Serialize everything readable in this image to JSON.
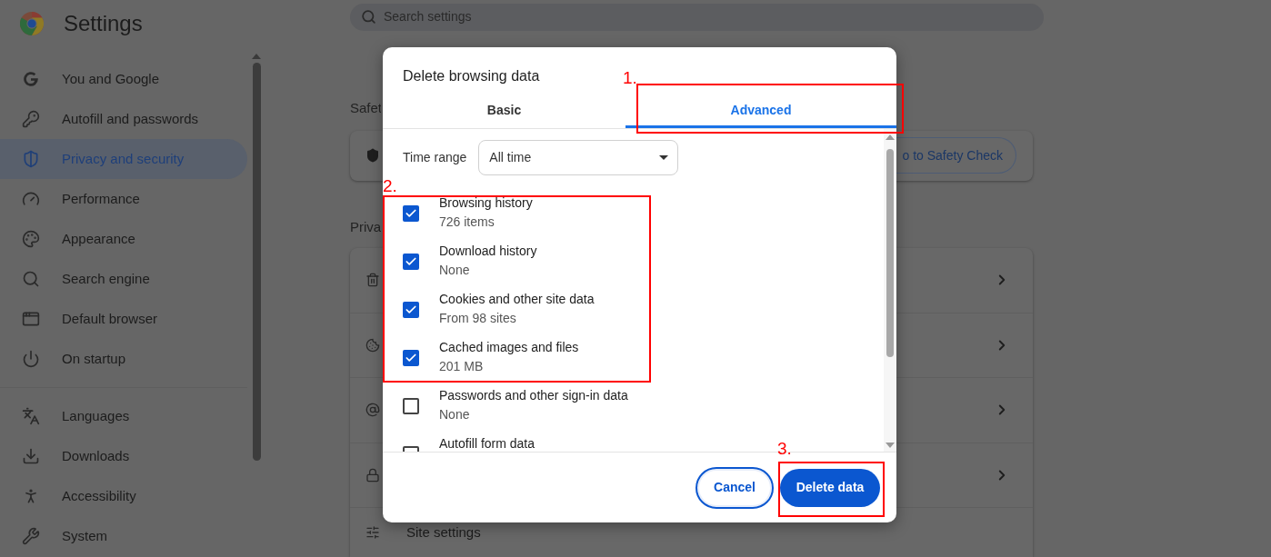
{
  "header": {
    "title": "Settings",
    "search": {
      "placeholder": "Search settings"
    }
  },
  "sidebar": {
    "groups": [
      [
        {
          "label": "You and Google",
          "selected": false
        },
        {
          "label": "Autofill and passwords",
          "selected": false
        },
        {
          "label": "Privacy and security",
          "selected": true
        },
        {
          "label": "Performance",
          "selected": false
        },
        {
          "label": "Appearance",
          "selected": false
        },
        {
          "label": "Search engine",
          "selected": false
        },
        {
          "label": "Default browser",
          "selected": false
        },
        {
          "label": "On startup",
          "selected": false
        }
      ],
      [
        {
          "label": "Languages",
          "selected": false
        },
        {
          "label": "Downloads",
          "selected": false
        },
        {
          "label": "Accessibility",
          "selected": false
        },
        {
          "label": "System",
          "selected": false
        }
      ]
    ]
  },
  "main": {
    "safety": {
      "heading": "Safet",
      "button": "o to Safety Check"
    },
    "privacy": {
      "heading": "Priva",
      "last_row": "Site settings"
    }
  },
  "dialog": {
    "title": "Delete browsing data",
    "tabs": [
      {
        "label": "Basic",
        "selected": false
      },
      {
        "label": "Advanced",
        "selected": true
      }
    ],
    "time_range": {
      "label": "Time range",
      "value": "All time"
    },
    "items": [
      {
        "label": "Browsing history",
        "detail": "726 items",
        "checked": true
      },
      {
        "label": "Download history",
        "detail": "None",
        "checked": true
      },
      {
        "label": "Cookies and other site data",
        "detail": "From 98 sites",
        "checked": true
      },
      {
        "label": "Cached images and files",
        "detail": "201 MB",
        "checked": true
      },
      {
        "label": "Passwords and other sign-in data",
        "detail": "None",
        "checked": false
      },
      {
        "label": "Autofill form data",
        "checked": false
      }
    ],
    "buttons": {
      "cancel": "Cancel",
      "confirm": "Delete data"
    }
  },
  "annotations": [
    {
      "label": "1."
    },
    {
      "label": "2."
    },
    {
      "label": "3."
    }
  ]
}
